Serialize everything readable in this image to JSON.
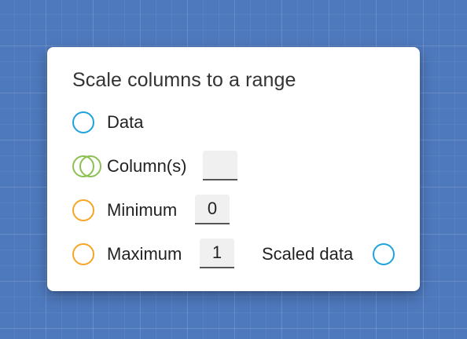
{
  "node": {
    "title": "Scale columns to a range",
    "rows": {
      "data": {
        "label": "Data",
        "port_color": "#1fa3dc"
      },
      "columns": {
        "label": "Column(s)",
        "value": "",
        "port_color": "#8cc152"
      },
      "minimum": {
        "label": "Minimum",
        "value": "0",
        "port_color": "#f5a623"
      },
      "maximum": {
        "label": "Maximum",
        "value": "1",
        "port_color": "#f5a623"
      },
      "scaled_data": {
        "label": "Scaled data",
        "port_color": "#1fa3dc"
      }
    }
  }
}
